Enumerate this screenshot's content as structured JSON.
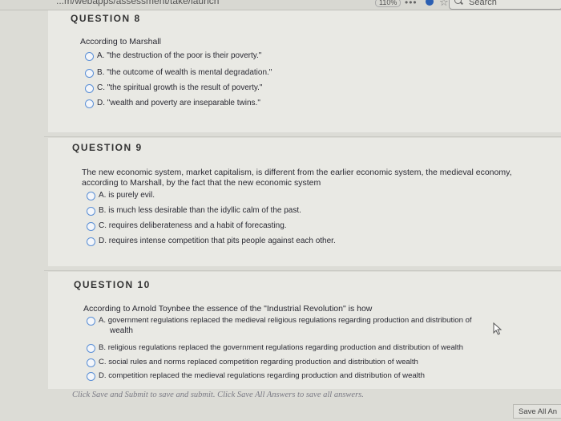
{
  "browser": {
    "url_fragment": "...m/webapps/assessment/take/launch",
    "zoom": "110%",
    "search_label": "Search"
  },
  "questions": [
    {
      "header": "QUESTION 8",
      "stem": "According to Marshall",
      "options": [
        "A. \"the destruction of the poor is their poverty.\"",
        "B. \"the outcome of wealth is mental degradation.\"",
        "C. \"the spiritual growth is the result of poverty.\"",
        "D. \"wealth and poverty are inseparable twins.\""
      ]
    },
    {
      "header": "QUESTION 9",
      "stem_line1": "The new economic system, market capitalism, is different from the earlier economic system, the medieval economy,",
      "stem_line2": "according to Marshall, by the fact that the new economic system",
      "options": [
        "A. is purely evil.",
        "B. is much less desirable than the idyllic calm of the past.",
        "C. requires deliberateness and a habit of forecasting.",
        "D. requires intense competition that pits people against each other."
      ]
    },
    {
      "header": "QUESTION 10",
      "stem": "According to Arnold Toynbee the essence of the \"Industrial Revolution\" is how",
      "options": [
        "A. government regulations replaced the medieval religious regulations regarding production and distribution of",
        "B. religious regulations replaced the government regulations regarding production and distribution of wealth",
        "C. social rules and norms replaced competition regarding production and distribution of wealth",
        "D. competition replaced the medieval regulations regarding production and distribution of wealth"
      ],
      "option_a_wrap": "wealth"
    }
  ],
  "footer": {
    "note": "Click Save and Submit to save and submit. Click Save All Answers to save all answers.",
    "save_all_button": "Save All An"
  },
  "colors": {
    "radio_border": "#5a8fd6",
    "background": "#e9e9e4"
  }
}
